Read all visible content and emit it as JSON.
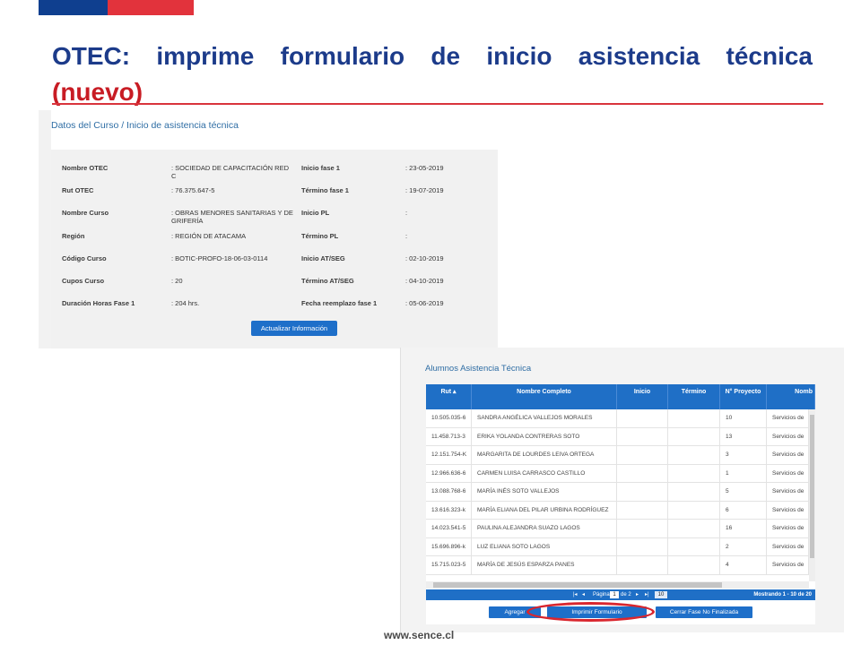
{
  "title": {
    "line1": "OTEC: imprime formulario de inicio asistencia técnica",
    "line2": "(nuevo)"
  },
  "colors": {
    "flag_blue": "#0f3f8f",
    "flag_red": "#e2333c",
    "title_blue": "#1c3b8a",
    "title_red": "#c81c24",
    "accent": "#1f6fc6",
    "highlight_circle": "#d9262e"
  },
  "datos": {
    "heading": "Datos del Curso / Inicio de asistencia técnica",
    "rows": [
      {
        "label_l": "Nombre OTEC",
        "value_l": ": SOCIEDAD DE CAPACITACIÓN RED C",
        "label_r": "Inicio fase 1",
        "value_r": ": 23-05-2019"
      },
      {
        "label_l": "Rut OTEC",
        "value_l": ": 76.375.647-5",
        "label_r": "Término fase 1",
        "value_r": ": 19-07-2019"
      },
      {
        "label_l": "Nombre Curso",
        "value_l": ": OBRAS MENORES SANITARIAS Y DE GRIFERÍA",
        "label_r": "Inicio PL",
        "value_r": ":"
      },
      {
        "label_l": "Región",
        "value_l": ": REGIÓN DE ATACAMA",
        "label_r": "Término PL",
        "value_r": ":"
      },
      {
        "label_l": "Código Curso",
        "value_l": ": BOTIC-PROFO-18-06-03-0114",
        "label_r": "Inicio AT/SEG",
        "value_r": ": 02-10-2019"
      },
      {
        "label_l": "Cupos Curso",
        "value_l": ": 20",
        "label_r": "Término AT/SEG",
        "value_r": ": 04-10-2019"
      },
      {
        "label_l": "Duración Horas Fase 1",
        "value_l": ": 204 hrs.",
        "label_r": "Fecha reemplazo fase 1",
        "value_r": ": 05-06-2019"
      }
    ],
    "button_label": "Actualizar Información"
  },
  "alumnos": {
    "heading": "Alumnos Asistencia Técnica",
    "columns": [
      "Rut ▴",
      "Nombre Completo",
      "Inicio",
      "Término",
      "N° Proyecto",
      "Nomb"
    ],
    "rows": [
      {
        "rut": "10.505.035-6",
        "nombre": "SANDRA ANGÉLICA VALLEJOS MORALES",
        "inicio": "",
        "termino": "",
        "proyecto": "10",
        "nomb": "Servicios de"
      },
      {
        "rut": "11.458.713-3",
        "nombre": "ERIKA YOLANDA CONTRERAS SOTO",
        "inicio": "",
        "termino": "",
        "proyecto": "13",
        "nomb": "Servicios de"
      },
      {
        "rut": "12.151.754-K",
        "nombre": "MARGARITA DE LOURDES LEIVA ORTEGA",
        "inicio": "",
        "termino": "",
        "proyecto": "3",
        "nomb": "Servicios de"
      },
      {
        "rut": "12.966.636-6",
        "nombre": "CARMEN LUISA CARRASCO CASTILLO",
        "inicio": "",
        "termino": "",
        "proyecto": "1",
        "nomb": "Servicios de"
      },
      {
        "rut": "13.088.768-6",
        "nombre": "MARÍA INÉS SOTO VALLEJOS",
        "inicio": "",
        "termino": "",
        "proyecto": "5",
        "nomb": "Servicios de"
      },
      {
        "rut": "13.616.323-k",
        "nombre": "MARÍA ELIANA DEL PILAR URBINA RODRÍGUEZ",
        "inicio": "",
        "termino": "",
        "proyecto": "6",
        "nomb": "Servicios de"
      },
      {
        "rut": "14.023.541-5",
        "nombre": "PAULINA ALEJANDRA SUAZO LAGOS",
        "inicio": "",
        "termino": "",
        "proyecto": "16",
        "nomb": "Servicios de"
      },
      {
        "rut": "15.696.896-k",
        "nombre": "LUZ ELIANA SOTO LAGOS",
        "inicio": "",
        "termino": "",
        "proyecto": "2",
        "nomb": "Servicios de"
      },
      {
        "rut": "15.715.023-5",
        "nombre": "MARÍA DE JESÚS ESPARZA PANES",
        "inicio": "",
        "termino": "",
        "proyecto": "4",
        "nomb": "Servicios de"
      }
    ],
    "pager": {
      "first": "|◂",
      "prev": "◂",
      "page_label": "Página",
      "page_value": "1",
      "of_label": "de 2",
      "next": "▸",
      "last": "▸|",
      "page_size": "10",
      "range": "Mostrando 1 - 10 de 20"
    },
    "buttons": {
      "agregar": "Agregar",
      "imprimir": "Imprimir Formulario",
      "cerrar": "Cerrar Fase No Finalizada"
    }
  },
  "footer": {
    "url": "www.sence.cl"
  }
}
